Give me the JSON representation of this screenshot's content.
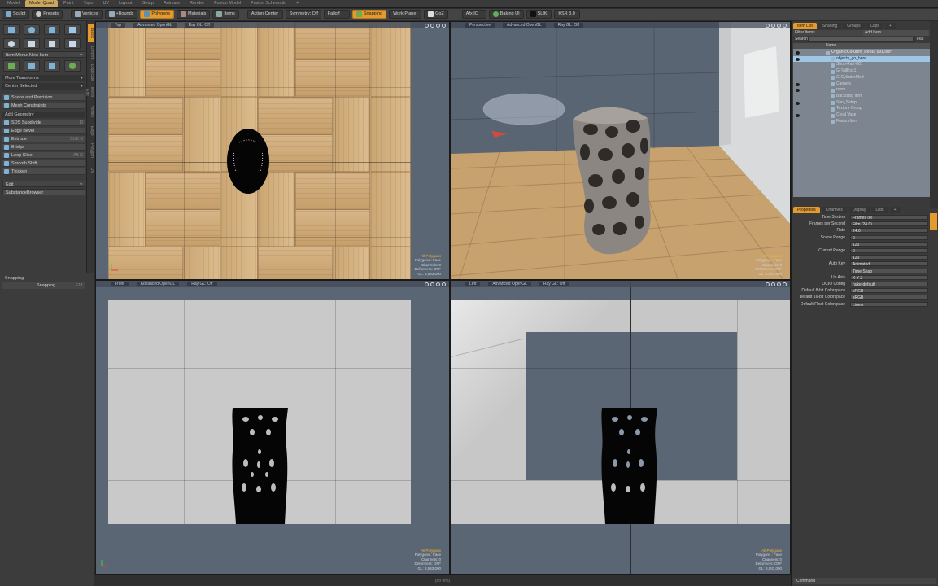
{
  "layout_tabs": [
    "Model",
    "Model Quad",
    "Paint",
    "Topo",
    "UV",
    "Layout",
    "Setup",
    "Animate",
    "Render",
    "Fusion Model",
    "Fusion Schematic",
    "+"
  ],
  "layout_active": "Model Quad",
  "toolbar": {
    "sculpt": "Sculpt",
    "presets": "Presets",
    "vertices": "Vertices",
    "edges": "+Bounds",
    "polygons": "Polygons",
    "materials": "Materials",
    "items": "Items",
    "action_center": "Action Center",
    "symmetry": "Symmetry: Off",
    "falloff": "Falloff",
    "snapping": "Snapping",
    "work_plane": "Work Plane",
    "goz": "GoZ",
    "afx": "Afx IO",
    "baking": "Baking UI",
    "slik": "SLIK",
    "ksr": "KSR 3.0"
  },
  "left_panel": {
    "item_menu": "Item Menu: New Item",
    "more_transforms": "More Transforms",
    "center_selected": "Center Selected",
    "snaps": "Snaps and Precision",
    "mesh_constraints": "Mesh Constraints",
    "add_geometry": "Add Geometry",
    "tools": [
      {
        "label": "SDS Subdivide",
        "hotkey": "D"
      },
      {
        "label": "Edge Bevel",
        "hotkey": ""
      },
      {
        "label": "Extrude",
        "hotkey": "Shift X"
      },
      {
        "label": "Bridge",
        "hotkey": ""
      },
      {
        "label": "Loop Slice",
        "hotkey": "Alt C"
      },
      {
        "label": "Smooth Shift",
        "hotkey": ""
      },
      {
        "label": "Thicken",
        "hotkey": ""
      }
    ],
    "edit": "Edit",
    "substance": "SubstanceBrowser",
    "snapping_header": "Snapping",
    "snapping_row": "Snapping",
    "snapping_value": "F11",
    "side_tabs": [
      "Basic",
      "Deform",
      "Duplicate",
      "Mesh Edit",
      "Vertex",
      "Edge",
      "Polygon",
      "UV"
    ]
  },
  "viewports": [
    {
      "id": "top",
      "label": "Top",
      "shading": "Advanced OpenGL",
      "renderer": "Ray GL: Off",
      "stats": [
        "All Polygons",
        "Polygons : Face",
        "Channels: 0",
        "Deformers: OFF",
        "GL: 3,583,000"
      ],
      "bottom": "Top"
    },
    {
      "id": "perspective",
      "label": "Perspective",
      "shading": "Advanced OpenGL",
      "renderer": "Ray GL: Off",
      "stats": [
        "All Polygons",
        "Polygons : Face",
        "Channels: 0",
        "Deformers: OFF",
        "GL: 3,583,000"
      ],
      "bottom": ""
    },
    {
      "id": "front",
      "label": "Front",
      "shading": "Advanced OpenGL",
      "renderer": "Ray GL: Off",
      "stats": [
        "All Polygons",
        "Polygons : Face",
        "Channels: 0",
        "Deformers: OFF",
        "GL: 3,583,000"
      ],
      "bottom": ""
    },
    {
      "id": "left",
      "label": "Left",
      "shading": "Advanced OpenGL",
      "renderer": "Ray GL: Off",
      "stats": [
        "All Polygons",
        "Polygons : Face",
        "Channels: 0",
        "Deformers: OFF",
        "GL: 3,583,000"
      ],
      "bottom": ""
    }
  ],
  "right_panel": {
    "tabs": [
      "Item List",
      "Shading",
      "Groups",
      "Clips",
      "+"
    ],
    "filter": "Filter Items",
    "add_item": "Add Item",
    "search": "Search",
    "flat": "Flat",
    "name_header": "Name",
    "items": [
      {
        "label": "OrganicColumn_Redu_001.lxo*",
        "indent": 0,
        "selected": false,
        "eye": true
      },
      {
        "label": "objects_go_here",
        "indent": 1,
        "selected": true,
        "eye": true
      },
      {
        "label": "Shop-Part-001",
        "indent": 1,
        "selected": false,
        "eye": false
      },
      {
        "label": "G-TallBox1",
        "indent": 1,
        "selected": false,
        "eye": false
      },
      {
        "label": "G-CylinderMed",
        "indent": 1,
        "selected": false,
        "eye": false
      },
      {
        "label": "Camera",
        "indent": 1,
        "selected": false,
        "eye": true
      },
      {
        "label": "room",
        "indent": 1,
        "selected": false,
        "eye": true
      },
      {
        "label": "Backdrop Item",
        "indent": 1,
        "selected": false,
        "eye": false
      },
      {
        "label": "Sun_Setup",
        "indent": 1,
        "selected": false,
        "eye": true
      },
      {
        "label": "Texture Group",
        "indent": 1,
        "selected": false,
        "eye": false
      },
      {
        "label": "Coral Vase",
        "indent": 1,
        "selected": false,
        "eye": true
      },
      {
        "label": "Fusion Item",
        "indent": 1,
        "selected": false,
        "eye": false
      }
    ],
    "prop_tabs": [
      "Properties",
      "Channels",
      "Display",
      "Lists",
      "+"
    ],
    "properties": [
      {
        "label": "Time System",
        "value": "Frames (0)"
      },
      {
        "label": "Frames per Second",
        "value": "Film (24.0)"
      },
      {
        "label": "Rate",
        "value": "24.0"
      },
      {
        "label": "Scene Range",
        "value": "0"
      },
      {
        "label": "",
        "value": "120"
      },
      {
        "label": "Current Range",
        "value": "0"
      },
      {
        "label": "",
        "value": "120"
      },
      {
        "label": "Auto Key",
        "value": "Animated"
      },
      {
        "label": "",
        "value": "Time Snap"
      },
      {
        "label": "Up Axis",
        "value": "X   Y   Z"
      },
      {
        "label": "OCIO Config",
        "value": "nuke-default"
      },
      {
        "label": "Default 8-bit Colorspace",
        "value": "sRGB"
      },
      {
        "label": "Default 16-bit Colorspace",
        "value": "sRGB"
      },
      {
        "label": "Default Float Colorspace",
        "value": "Linear"
      }
    ],
    "footer": "Command"
  },
  "status": "(no info)"
}
